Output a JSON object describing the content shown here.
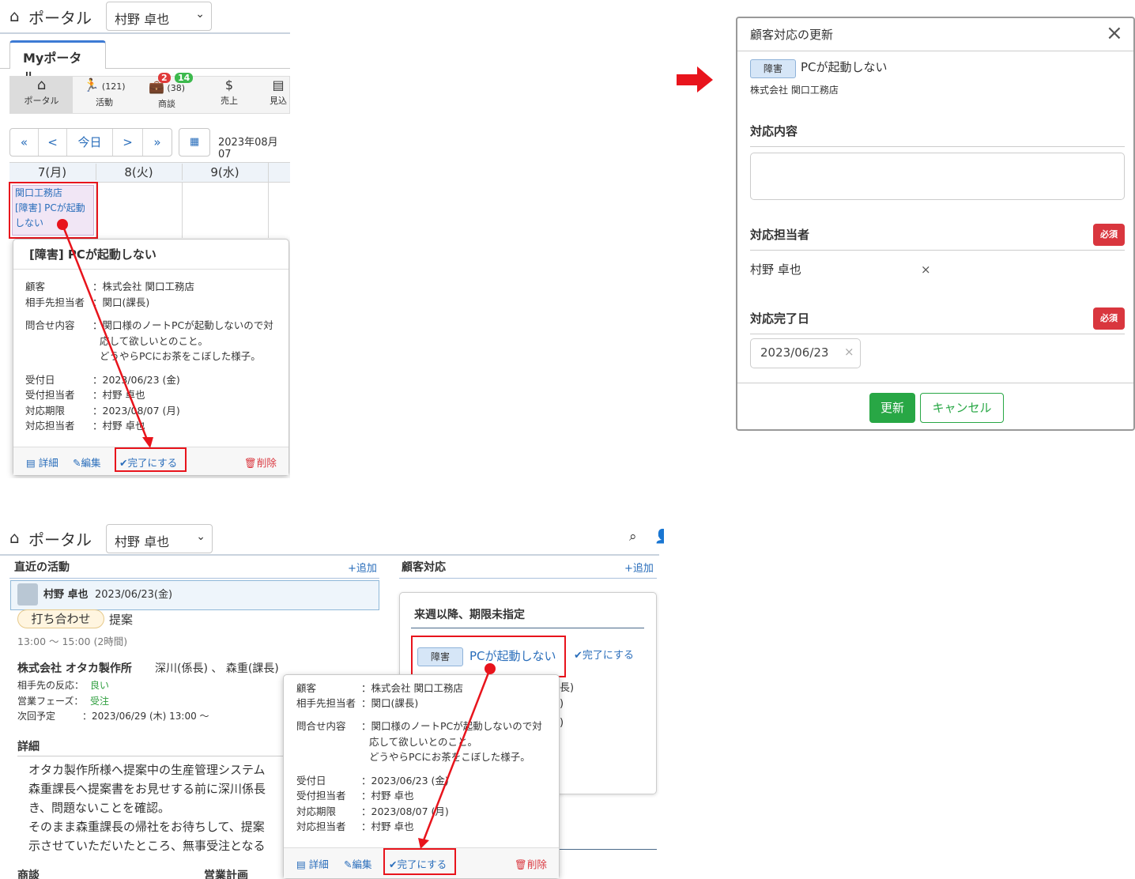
{
  "top_left": {
    "logo_text": "ポータル",
    "user_select": "村野 卓也",
    "tab_label": "Myポータル",
    "nav": [
      {
        "label": "ポータル",
        "count": ""
      },
      {
        "label": "活動",
        "count": "(121)"
      },
      {
        "label": "商談",
        "count": "(38)",
        "badge_red": "2",
        "badge_green": "14"
      },
      {
        "label": "売上",
        "count": ""
      },
      {
        "label": "見込",
        "count": ""
      }
    ],
    "pager": [
      "«",
      "<",
      "今日",
      ">",
      "»"
    ],
    "date": "2023年08月07",
    "days": [
      "7(月)",
      "8(火)",
      "9(水)"
    ],
    "event_lines": [
      "関口工務店",
      "[障害] PCが起動",
      "しない"
    ],
    "popover": {
      "title": "[障害] PCが起動しない",
      "rows": [
        {
          "k": "顧客",
          "v": "：株式会社 関口工務店"
        },
        {
          "k": "相手先担当者",
          "v": "：関口(課長)"
        },
        {
          "k": "問合せ内容",
          "v": "：関口様のノートPCが起動しないので対"
        },
        {
          "k": "",
          "v": "応して欲しいとのこと。"
        },
        {
          "k": "",
          "v": "どうやらPCにお茶をこぼした様子。"
        },
        {
          "k": "受付日",
          "v": "：2023/06/23 (金)"
        },
        {
          "k": "受付担当者",
          "v": "：村野 卓也"
        },
        {
          "k": "対応期限",
          "v": "：2023/08/07 (月)"
        },
        {
          "k": "対応担当者",
          "v": "：村野 卓也"
        }
      ],
      "actions": {
        "detail": "詳細",
        "edit": "編集",
        "complete": "✔完了にする",
        "delete": "削除"
      }
    }
  },
  "modal": {
    "title": "顧客対応の更新",
    "close": "×",
    "tag": "障害",
    "subject": "PCが起動しない",
    "customer": "株式会社 関口工務店",
    "content_label": "対応内容",
    "assignee_label": "対応担当者",
    "required": "必須",
    "assignee": "村野 卓也",
    "clear": "×",
    "done_label": "対応完了日",
    "done_date": "2023/06/23",
    "update_btn": "更新",
    "cancel_btn": "キャンセル"
  },
  "bottom": {
    "logo_text": "ポータル",
    "user_select": "村野 卓也",
    "recent_title": "直近の活動",
    "add": "+追加",
    "cs_title": "顧客対応",
    "activity_user": "村野 卓也",
    "activity_date": "2023/06/23(金)",
    "meeting_tag": "打ち合わせ",
    "meeting_type": "提案",
    "time": "13:00 ～ 15:00 (2時間)",
    "company": "株式会社 オタカ製作所",
    "contacts": "深川(係長) 、 森重(課長)",
    "reaction_label": "相手先の反応：",
    "reaction": "良い",
    "phase_label": "営業フェーズ：",
    "phase": "受注",
    "next_label": "次回予定",
    "next": "：2023/06/29 (木) 13:00 ～",
    "detail_title": "詳細",
    "detail_lines": [
      "オタカ製作所様へ提案中の生産管理システム",
      "森重課長へ提案書をお見せする前に深川係長",
      "き、問題ないことを確認。",
      "そのまま森重課長の帰社をお待ちして、提案",
      "示させていただいたところ、無事受注となる"
    ],
    "bottom_labels": [
      "商談",
      "営業計画"
    ],
    "period_title": "来週以降、期限未指定",
    "cs_tag": "障害",
    "cs_subject": "PCが起動しない",
    "cs_complete": "✔完了にする",
    "behind_fragments": [
      "長)",
      ")",
      ")"
    ],
    "popover": {
      "rows": [
        {
          "k": "顧客",
          "v": "：株式会社 関口工務店"
        },
        {
          "k": "相手先担当者",
          "v": "：関口(課長)"
        },
        {
          "k": "問合せ内容",
          "v": "：関口様のノートPCが起動しないので対"
        },
        {
          "k": "",
          "v": "応して欲しいとのこと。"
        },
        {
          "k": "",
          "v": "どうやらPCにお茶をこぼした様子。"
        },
        {
          "k": "受付日",
          "v": "：2023/06/23 (金)"
        },
        {
          "k": "受付担当者",
          "v": "：村野 卓也"
        },
        {
          "k": "対応期限",
          "v": "：2023/08/07 (月)"
        },
        {
          "k": "対応担当者",
          "v": "：村野 卓也"
        }
      ],
      "actions": {
        "detail": "詳細",
        "edit": "編集",
        "complete": "✔完了にする",
        "delete": "削除"
      }
    }
  },
  "colors": {
    "accent": "#2a6ebb",
    "arrow": "#e8141c",
    "success": "#28a745",
    "danger": "#d9363e"
  }
}
